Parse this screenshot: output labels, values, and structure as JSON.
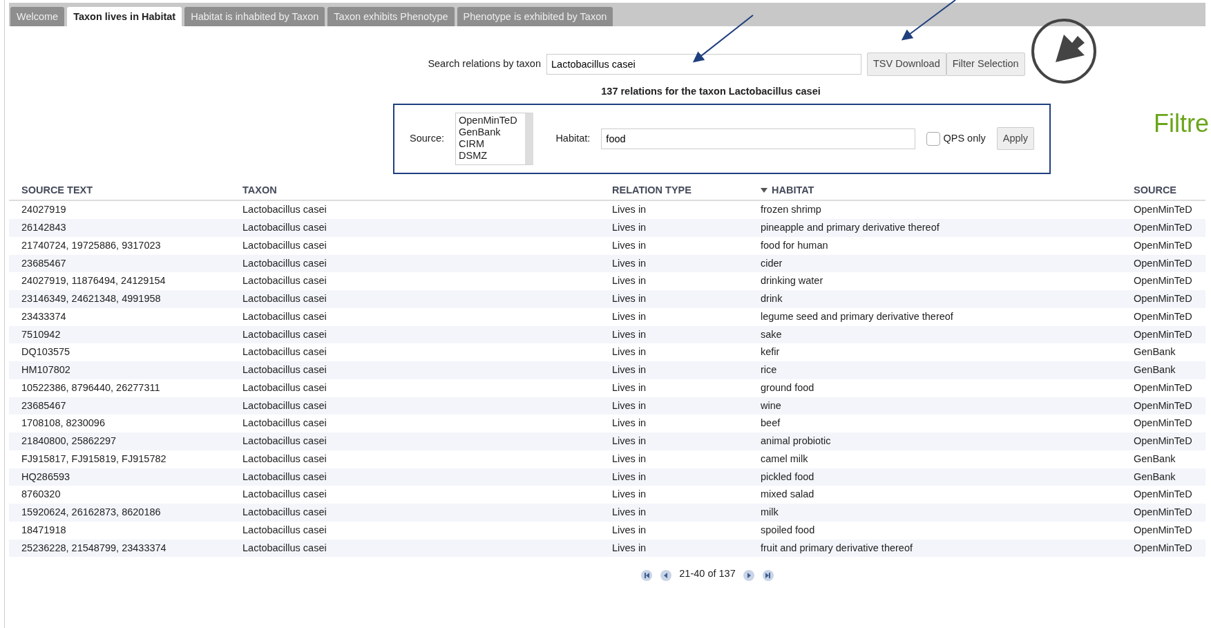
{
  "tabs": [
    {
      "label": "Welcome",
      "selected": false
    },
    {
      "label": "Taxon lives in Habitat",
      "selected": true
    },
    {
      "label": "Habitat is inhabited by Taxon",
      "selected": false
    },
    {
      "label": "Taxon exhibits Phenotype",
      "selected": false
    },
    {
      "label": "Phenotype is exhibited by Taxon",
      "selected": false
    }
  ],
  "search": {
    "label": "Search relations by taxon",
    "value": "Lactobacillus casei"
  },
  "buttons": [
    "TSV Download",
    "Filter Selection"
  ],
  "summary": "137 relations for the taxon Lactobacillus casei",
  "filter": {
    "source_label": "Source:",
    "source_options": [
      "OpenMinTeD",
      "GenBank",
      "CIRM",
      "DSMZ"
    ],
    "habitat_label": "Habitat:",
    "habitat_value": "food",
    "qps_label": "QPS only",
    "qps_checked": false,
    "apply": "Apply"
  },
  "table": {
    "columns": [
      {
        "label": "SOURCE TEXT",
        "sorted": false
      },
      {
        "label": "TAXON",
        "sorted": false
      },
      {
        "label": "RELATION TYPE",
        "sorted": false
      },
      {
        "label": "HABITAT",
        "sorted": true
      },
      {
        "label": "SOURCE",
        "sorted": false
      }
    ],
    "rows": [
      [
        "24027919",
        "Lactobacillus casei",
        "Lives in",
        "frozen shrimp",
        "OpenMinTeD"
      ],
      [
        "26142843",
        "Lactobacillus casei",
        "Lives in",
        "pineapple and primary derivative thereof",
        "OpenMinTeD"
      ],
      [
        "21740724, 19725886, 9317023",
        "Lactobacillus casei",
        "Lives in",
        "food for human",
        "OpenMinTeD"
      ],
      [
        "23685467",
        "Lactobacillus casei",
        "Lives in",
        "cider",
        "OpenMinTeD"
      ],
      [
        "24027919, 11876494, 24129154",
        "Lactobacillus casei",
        "Lives in",
        "drinking water",
        "OpenMinTeD"
      ],
      [
        "23146349, 24621348, 4991958",
        "Lactobacillus casei",
        "Lives in",
        "drink",
        "OpenMinTeD"
      ],
      [
        "23433374",
        "Lactobacillus casei",
        "Lives in",
        "legume seed and primary derivative thereof",
        "OpenMinTeD"
      ],
      [
        "7510942",
        "Lactobacillus casei",
        "Lives in",
        "sake",
        "OpenMinTeD"
      ],
      [
        "DQ103575",
        "Lactobacillus casei",
        "Lives in",
        "kefir",
        "GenBank"
      ],
      [
        "HM107802",
        "Lactobacillus casei",
        "Lives in",
        "rice",
        "GenBank"
      ],
      [
        "10522386, 8796440, 26277311",
        "Lactobacillus casei",
        "Lives in",
        "ground food",
        "OpenMinTeD"
      ],
      [
        "23685467",
        "Lactobacillus casei",
        "Lives in",
        "wine",
        "OpenMinTeD"
      ],
      [
        "1708108, 8230096",
        "Lactobacillus casei",
        "Lives in",
        "beef",
        "OpenMinTeD"
      ],
      [
        "21840800, 25862297",
        "Lactobacillus casei",
        "Lives in",
        "animal probiotic",
        "OpenMinTeD"
      ],
      [
        "FJ915817, FJ915819, FJ915782",
        "Lactobacillus casei",
        "Lives in",
        "camel milk",
        "GenBank"
      ],
      [
        "HQ286593",
        "Lactobacillus casei",
        "Lives in",
        "pickled food",
        "GenBank"
      ],
      [
        "8760320",
        "Lactobacillus casei",
        "Lives in",
        "mixed salad",
        "OpenMinTeD"
      ],
      [
        "15920624, 26162873, 8620186",
        "Lactobacillus casei",
        "Lives in",
        "milk",
        "OpenMinTeD"
      ],
      [
        "18471918",
        "Lactobacillus casei",
        "Lives in",
        "spoiled food",
        "OpenMinTeD"
      ],
      [
        "25236228, 21548799, 23433374",
        "Lactobacillus casei",
        "Lives in",
        "fruit and primary derivative thereof",
        "OpenMinTeD"
      ]
    ]
  },
  "pagination": {
    "text": "21-40 of 137"
  },
  "annotation": {
    "text": "Filtre"
  }
}
